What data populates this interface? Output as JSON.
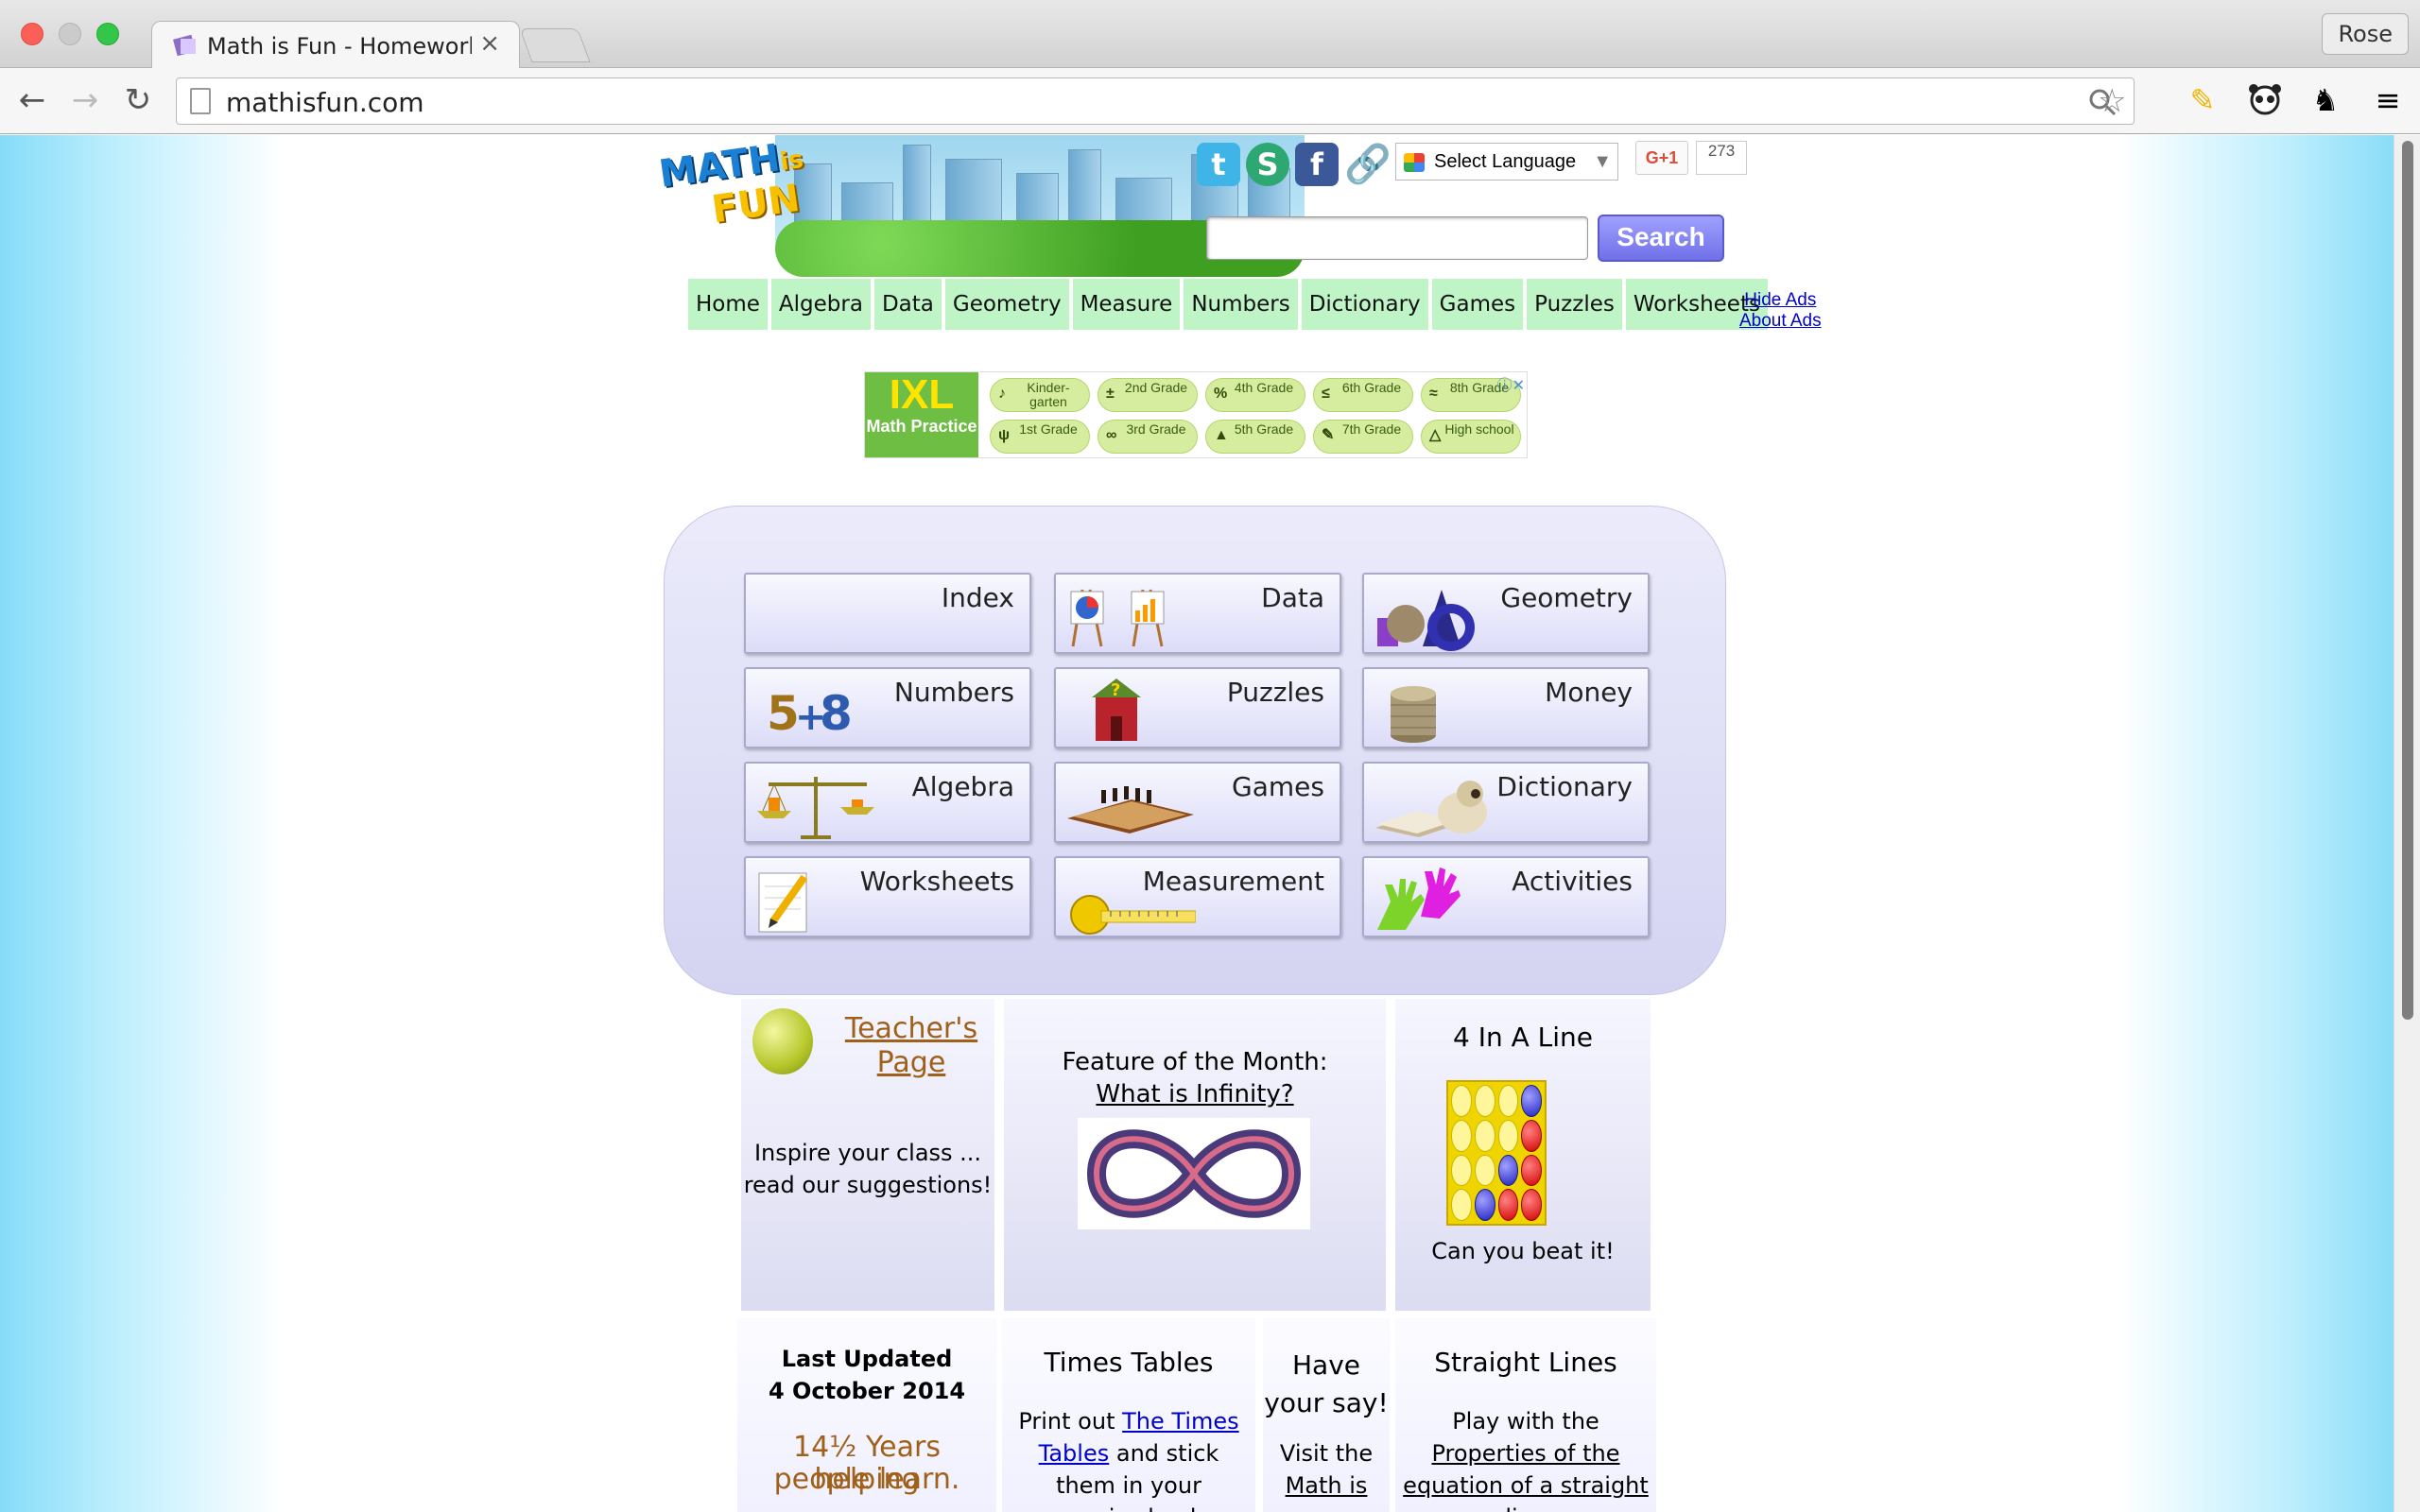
{
  "browser": {
    "tab_title": "Math is Fun - Homework H",
    "tab_close": "×",
    "profile_name": "Rose",
    "url": "mathisfun.com"
  },
  "header": {
    "language_select": "Select Language",
    "gplus_label": "G+1",
    "gplus_count": "273",
    "search_button": "Search",
    "search_placeholder": "",
    "logo_line1": "MATH",
    "logo_line2": "is",
    "logo_line3": "FUN"
  },
  "topnav": [
    "Home",
    "Algebra",
    "Data",
    "Geometry",
    "Measure",
    "Numbers",
    "Dictionary",
    "Games",
    "Puzzles",
    "Worksheets"
  ],
  "ad_links": {
    "hide": "Hide Ads",
    "about": "About Ads"
  },
  "ad": {
    "brand": "IXL",
    "brand_sub": "Math Practice",
    "pills": [
      {
        "glyph": "♪",
        "text": "Kinder- garten"
      },
      {
        "glyph": "±",
        "text": "2nd Grade"
      },
      {
        "glyph": "%",
        "text": "4th Grade"
      },
      {
        "glyph": "≤",
        "text": "6th Grade"
      },
      {
        "glyph": "≈",
        "text": "8th Grade"
      },
      {
        "glyph": "ψ",
        "text": "1st Grade"
      },
      {
        "glyph": "∞",
        "text": "3rd Grade"
      },
      {
        "glyph": "▲",
        "text": "5th Grade"
      },
      {
        "glyph": "✎",
        "text": "7th Grade"
      },
      {
        "glyph": "△",
        "text": "High school"
      }
    ]
  },
  "menu": [
    {
      "label": "Index",
      "icon": "none"
    },
    {
      "label": "Data",
      "icon": "easel-chart-icon"
    },
    {
      "label": "Geometry",
      "icon": "shapes-icon"
    },
    {
      "label": "Numbers",
      "icon": "5plus8-icon"
    },
    {
      "label": "Puzzles",
      "icon": "puzzle-house-icon"
    },
    {
      "label": "Money",
      "icon": "coin-stack-icon"
    },
    {
      "label": "Algebra",
      "icon": "balance-scale-icon"
    },
    {
      "label": "Games",
      "icon": "chessboard-icon"
    },
    {
      "label": "Dictionary",
      "icon": "dog-book-icon"
    },
    {
      "label": "Worksheets",
      "icon": "pencil-paper-icon"
    },
    {
      "label": "Measurement",
      "icon": "tape-measure-icon"
    },
    {
      "label": "Activities",
      "icon": "hands-icon"
    }
  ],
  "teacher": {
    "title": "Teacher's Page",
    "line1": "Inspire your class ...",
    "line2": "read our suggestions!"
  },
  "feature": {
    "title": "Feature of the Month:",
    "link": "What is Infinity?"
  },
  "game": {
    "title": "4 In A Line",
    "caption": "Can you beat it!",
    "board": [
      "y",
      "y",
      "y",
      "b",
      "y",
      "y",
      "y",
      "r",
      "y",
      "y",
      "b",
      "r",
      "y",
      "b",
      "r",
      "r"
    ]
  },
  "updated": {
    "label": "Last Updated",
    "date": "4 October 2014",
    "years_line1": "14½ Years helping",
    "years_line2": "people learn."
  },
  "times": {
    "title": "Times Tables",
    "text1": "Print out",
    "link": "The Times Tables",
    "text2": "and stick them in your exercise book."
  },
  "say": {
    "title": "Have your say!",
    "text": "Visit the",
    "link": "Math is"
  },
  "lines": {
    "title": "Straight Lines",
    "text": "Play with the",
    "link": "Properties of the equation of a straight line"
  }
}
